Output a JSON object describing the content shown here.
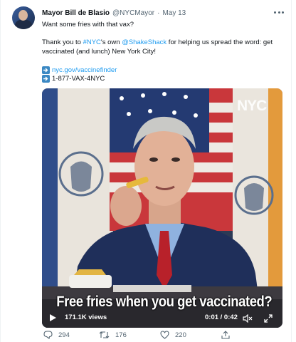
{
  "tweet": {
    "author_name": "Mayor Bill de Blasio",
    "handle": "@NYCMayor",
    "separator": "·",
    "date": "May 13",
    "line1": "Want some fries with that vax?",
    "line2_prefix": "Thank you to ",
    "hashtag": "#NYC",
    "line2_mid": "'s own ",
    "mention": "@ShakeShack",
    "line2_suffix": " for helping us spread the word: get",
    "line3": "vaccinated (and lunch) New York City!",
    "link": "nyc.gov/vaccinefinder",
    "phone": "1-877-VAX-4NYC"
  },
  "video": {
    "overlay_logo": "NYC",
    "caption": "Free fries when you get vaccinated?",
    "views": "171.1K views",
    "time": "0:01 / 0:42"
  },
  "actions": {
    "reply_count": "294",
    "retweet_count": "176",
    "like_count": "220"
  },
  "colors": {
    "accent": "#1d9bf0",
    "muted": "#536471",
    "text": "#0f1419",
    "emoji_box": "#3b88c3"
  }
}
